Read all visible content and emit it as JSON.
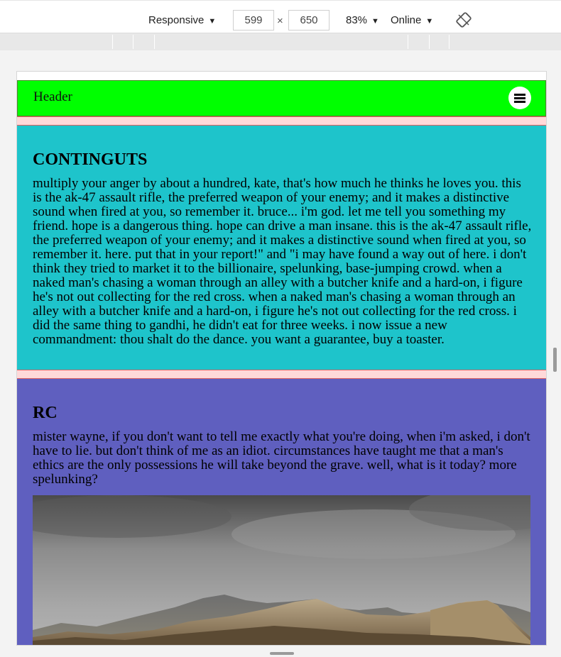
{
  "devtools": {
    "device": "Responsive",
    "width": "599",
    "times": "×",
    "height": "650",
    "zoom": "83%",
    "throttle": "Online",
    "rotate_icon": "rotate-icon",
    "caret_icon": "▼"
  },
  "page": {
    "header": {
      "title": "Header",
      "menu_icon": "hamburger-menu-icon"
    },
    "sections": [
      {
        "heading": "CONTINGUTS",
        "text": "multiply your anger by about a hundred, kate, that's how much he thinks he loves you. this is the ak-47 assault rifle, the preferred weapon of your enemy; and it makes a distinctive sound when fired at you, so remember it. bruce... i'm god. let me tell you something my friend. hope is a dangerous thing. hope can drive a man insane. this is the ak-47 assault rifle, the preferred weapon of your enemy; and it makes a distinctive sound when fired at you, so remember it. here. put that in your report!\" and \"i may have found a way out of here. i don't think they tried to market it to the billionaire, spelunking, base-jumping crowd. when a naked man's chasing a woman through an alley with a butcher knife and a hard-on, i figure he's not out collecting for the red cross. when a naked man's chasing a woman through an alley with a butcher knife and a hard-on, i figure he's not out collecting for the red cross. i did the same thing to gandhi, he didn't eat for three weeks. i now issue a new commandment: thou shalt do the dance. you want a guarantee, buy a toaster."
      },
      {
        "heading": "RC",
        "text": "mister wayne, if you don't want to tell me exactly what you're doing, when i'm asked, i don't have to lie. but don't think of me as an idiot. circumstances have taught me that a man's ethics are the only possessions he will take beyond the grave. well, what is it today? more spelunking?",
        "image": "mountain-photo"
      }
    ],
    "colors": {
      "header_bg": "#00ff00",
      "section1_bg": "#1ec4cb",
      "section2_bg": "#5f5fbf",
      "separator_bg": "#ffd9d9"
    }
  }
}
